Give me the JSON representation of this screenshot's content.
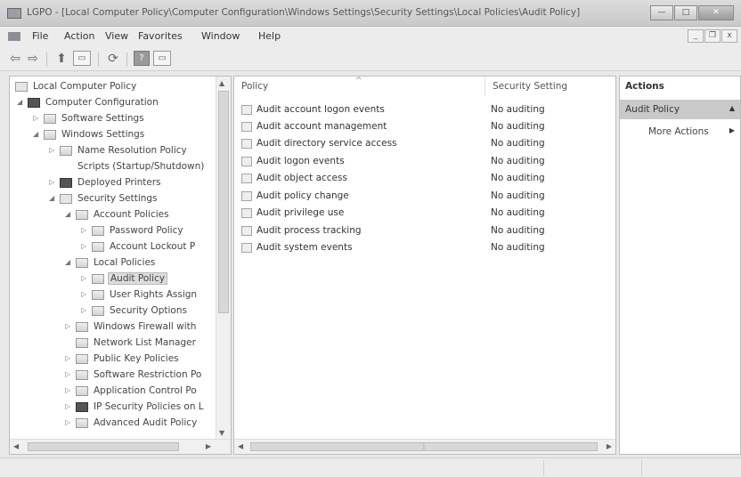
{
  "window": {
    "title": "LGPO - [Local Computer Policy\\Computer Configuration\\Windows Settings\\Security Settings\\Local Policies\\Audit Policy]",
    "buttons": {
      "minimize": "—",
      "maximize": "□",
      "close": "✕"
    }
  },
  "menubar": {
    "items": [
      "File",
      "Action",
      "View",
      "Favorites",
      "Window",
      "Help"
    ],
    "mdi_buttons": {
      "minimize": "_",
      "restore": "❐",
      "close": "x"
    }
  },
  "toolbar": {
    "back_glyph": "⇦",
    "forward_glyph": "⇨",
    "up_glyph": "⬆",
    "show_hide_glyph": "▭",
    "refresh_glyph": "⟳",
    "help_glyph": "?",
    "console_glyph": "▭"
  },
  "tree": {
    "items": [
      {
        "label": "Local Computer Policy",
        "expander": "",
        "icon": "policy-icon"
      },
      {
        "label": "Computer Configuration",
        "expander": "◢",
        "icon": "computer-icon"
      },
      {
        "label": "Software Settings",
        "expander": "▷",
        "icon": "folder-icon"
      },
      {
        "label": "Windows Settings",
        "expander": "◢",
        "icon": "folder-icon"
      },
      {
        "label": "Name Resolution Policy",
        "expander": "▷",
        "icon": "folder-icon"
      },
      {
        "label": "Scripts (Startup/Shutdown)",
        "expander": "",
        "icon": "scripts-icon"
      },
      {
        "label": "Deployed Printers",
        "expander": "▷",
        "icon": "printer-icon"
      },
      {
        "label": "Security Settings",
        "expander": "◢",
        "icon": "security-icon"
      },
      {
        "label": "Account Policies",
        "expander": "◢",
        "icon": "folder-icon"
      },
      {
        "label": "Password Policy",
        "expander": "▷",
        "icon": "folder-icon"
      },
      {
        "label": "Account Lockout P",
        "expander": "▷",
        "icon": "folder-icon"
      },
      {
        "label": "Local Policies",
        "expander": "◢",
        "icon": "folder-icon"
      },
      {
        "label": "Audit Policy",
        "expander": "▷",
        "icon": "folder-icon"
      },
      {
        "label": "User Rights Assign",
        "expander": "▷",
        "icon": "folder-icon"
      },
      {
        "label": "Security Options",
        "expander": "▷",
        "icon": "folder-icon"
      },
      {
        "label": "Windows Firewall with",
        "expander": "▷",
        "icon": "folder-icon"
      },
      {
        "label": "Network List Manager",
        "expander": "",
        "icon": "folder-icon"
      },
      {
        "label": "Public Key Policies",
        "expander": "▷",
        "icon": "folder-icon"
      },
      {
        "label": "Software Restriction Po",
        "expander": "▷",
        "icon": "folder-icon"
      },
      {
        "label": "Application Control Po",
        "expander": "▷",
        "icon": "folder-icon"
      },
      {
        "label": "IP Security Policies on L",
        "expander": "▷",
        "icon": "ipsec-icon"
      },
      {
        "label": "Advanced Audit Policy",
        "expander": "▷",
        "icon": "folder-icon"
      }
    ],
    "selected": "Audit Policy",
    "scroll_up": "▲",
    "scroll_down": "▼",
    "scroll_left": "◀",
    "scroll_right": "▶"
  },
  "list": {
    "columns": {
      "sort_indicator": "^",
      "policy": "Policy",
      "setting": "Security Setting"
    },
    "rows": [
      {
        "policy": "Audit account logon events",
        "setting": "No auditing"
      },
      {
        "policy": "Audit account management",
        "setting": "No auditing"
      },
      {
        "policy": "Audit directory service access",
        "setting": "No auditing"
      },
      {
        "policy": "Audit logon events",
        "setting": "No auditing"
      },
      {
        "policy": "Audit object access",
        "setting": "No auditing"
      },
      {
        "policy": "Audit policy change",
        "setting": "No auditing"
      },
      {
        "policy": "Audit privilege use",
        "setting": "No auditing"
      },
      {
        "policy": "Audit process tracking",
        "setting": "No auditing"
      },
      {
        "policy": "Audit system events",
        "setting": "No auditing"
      }
    ],
    "scroll_left": "◀",
    "scroll_right": "▶",
    "thumb_grip": "⋮"
  },
  "actions": {
    "header": "Actions",
    "section": "Audit Policy",
    "section_caret": "▲",
    "more_actions": "More Actions",
    "more_arrow": "▶"
  }
}
